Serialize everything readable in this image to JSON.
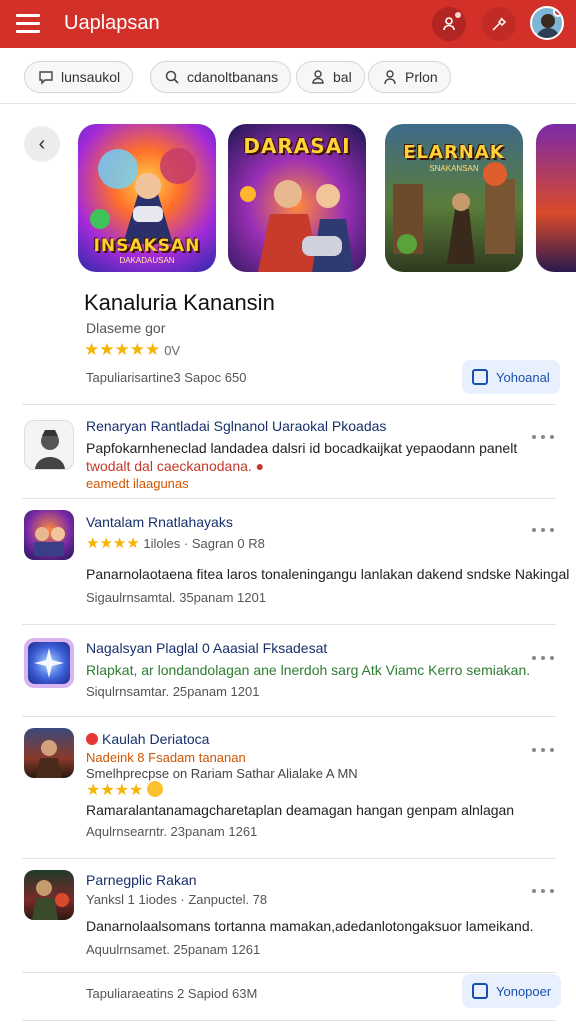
{
  "header": {
    "title": "Uaplapsan",
    "menu_icon": "hamburger-menu-icon",
    "user_icon": "user-icon",
    "tools_icon": "tools-icon",
    "colors": {
      "bar": "#d3302a",
      "accent": "#1a4fb0"
    }
  },
  "chips": [
    {
      "label": "lunsaukol",
      "icon": "chat-icon"
    },
    {
      "label": "cdanoltbanans",
      "icon": "search-icon"
    },
    {
      "label": "bal",
      "icon": "user-icon"
    },
    {
      "label": "Prlon",
      "icon": "person-icon"
    }
  ],
  "featured": {
    "tiles": [
      {
        "title": "INSAKSAN",
        "subtitle": "DAKADAUSAN"
      },
      {
        "title": "DARASAI",
        "subtitle": ""
      },
      {
        "title": "ELARNAK",
        "subtitle": "SNAKANSAN"
      }
    ],
    "app_title": "Kanaluria Kanansin",
    "publisher": "Dlaseme gor",
    "rating_stars": "★★★★★",
    "rating_value": "4.5",
    "rating_text": "0V",
    "meta": "Tapuliarisartine3 Sapoc 650",
    "action_label": "Yohoanal"
  },
  "list": [
    {
      "title": "Renaryan Rantladai Sglnanol Uaraokal Pkoadas",
      "line1": "Papfokarnheneclad landadea dalsri id bocadkaijkat yepaodann panelt",
      "line2": "twodalt dal caeckanodana. ●",
      "line3": "eamedt ilaagunas"
    },
    {
      "title": "Vantalam Rnatlahayaks",
      "rating_stars": "★★★★",
      "rating_value": "3.5",
      "sub": "1iloles · Sagran 0 R8",
      "line1": "Panarnolaotaena fitea laros tonaleningangu lanlakan dakend sndske Nakingal",
      "meta": "Sigaulrnsamtal. 35panam 1201"
    },
    {
      "title": "Nagalsyan Plaglal 0 Aaasial Fksadesat",
      "line1": "Rlapkat, ar londandolagan ane lnerdoh sarg Atk Viamc Kerro semiakan.",
      "meta": "Siqulrnsamtar. 25panam 1201"
    },
    {
      "title": "Kaulah Deriatoca",
      "sub1": "Nadeink 8 Fsadam tananan",
      "sub2": "Smelhprecpse on Rariam Sathar Alialake A MN",
      "rating_stars": "★★★★",
      "rating_value": "4.0",
      "line1": "Ramaralantanamagcharetaplan deamagan hangan genpam alnlagan",
      "meta": "Aqulrnsearntr. 23panam 1261"
    },
    {
      "title": "Parnegplic Rakan",
      "sub": "Yanksl 1 1iodes · Zanpuctel. 78",
      "line1": "Danarnolaalsomans tortanna mamakan,adedanlotongaksuor lameikand.",
      "meta": "Aquulrnsamet. 25panam 1261"
    }
  ],
  "footer": {
    "meta": "Tapuliaraeatins 2 Sapiod 63M",
    "action_label": "Yonopoer"
  }
}
